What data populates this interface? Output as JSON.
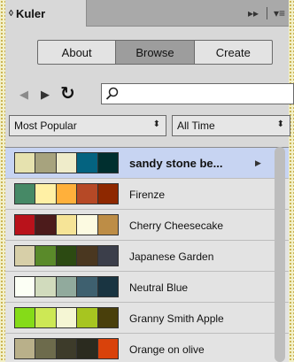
{
  "panel": {
    "title": "Kuler",
    "sort_glyph": "◊",
    "collapse_glyph": "▸▸",
    "menu_glyph": "▾≡"
  },
  "toolbar": {
    "tabs": [
      "About",
      "Browse",
      "Create"
    ],
    "active_tab": "Browse"
  },
  "nav": {
    "back_glyph": "◀",
    "forward_glyph": "▶",
    "refresh_glyph": "↻",
    "search_value": ""
  },
  "filters": {
    "sort_value": "Most Popular",
    "time_value": "All Time",
    "arrow_glyph": "⬍"
  },
  "themes": [
    {
      "name": "sandy stone be...",
      "selected": true,
      "colors": [
        "#e6e2af",
        "#a7a37e",
        "#efecca",
        "#046380",
        "#002f2f"
      ]
    },
    {
      "name": "Firenze",
      "selected": false,
      "colors": [
        "#468966",
        "#fff0a5",
        "#ffb03b",
        "#b64926",
        "#8e2800"
      ]
    },
    {
      "name": "Cherry Cheesecake",
      "selected": false,
      "colors": [
        "#b9121b",
        "#4c1b1b",
        "#f6e497",
        "#fcfae1",
        "#bd8d46"
      ]
    },
    {
      "name": "Japanese Garden",
      "selected": false,
      "colors": [
        "#d7cfa8",
        "#5a8a2a",
        "#2c4a12",
        "#4a3720",
        "#3b3e4a"
      ]
    },
    {
      "name": "Neutral Blue",
      "selected": false,
      "colors": [
        "#fcfff5",
        "#d1dbbd",
        "#91aa9d",
        "#3e606f",
        "#193441"
      ]
    },
    {
      "name": "Granny Smith Apple",
      "selected": false,
      "colors": [
        "#85db18",
        "#cde855",
        "#f5f6d4",
        "#a7c520",
        "#493f0b"
      ]
    },
    {
      "name": "Orange on olive",
      "selected": false,
      "colors": [
        "#b9b08a",
        "#6d6b4c",
        "#3d3b2a",
        "#2b2b1f",
        "#d9420b"
      ]
    }
  ],
  "selected_play_glyph": "▶"
}
